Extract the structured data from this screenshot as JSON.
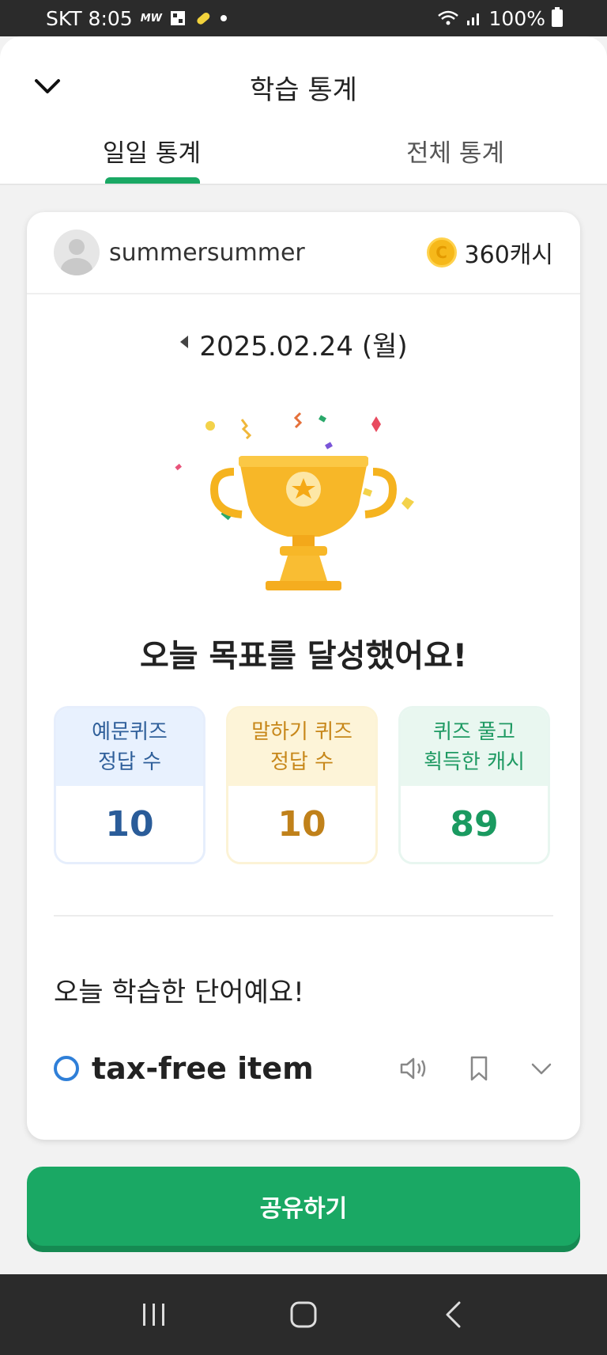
{
  "status_bar": {
    "carrier_time": "SKT 8:05",
    "mw": "MW",
    "battery": "100%"
  },
  "header": {
    "title": "학습 통계",
    "tabs": [
      {
        "label": "일일 통계",
        "active": true
      },
      {
        "label": "전체 통계",
        "active": false
      }
    ]
  },
  "profile": {
    "username": "summersummer",
    "cash": "360캐시",
    "coin_symbol": "C"
  },
  "date": "2025.02.24 (월)",
  "goal_message": "오늘 목표를 달성했어요!",
  "stats": [
    {
      "label": "예문퀴즈\n정답 수",
      "value": "10"
    },
    {
      "label": "말하기 퀴즈\n정답 수",
      "value": "10"
    },
    {
      "label": "퀴즈 풀고\n획득한 캐시",
      "value": "89"
    }
  ],
  "words_section": {
    "title": "오늘 학습한 단어예요!",
    "items": [
      {
        "word": "tax-free item"
      }
    ]
  },
  "share_button": "공유하기",
  "colors": {
    "accent_green": "#1aa864",
    "blue": "#2a5c99",
    "gold": "#c0811a",
    "coin": "#f6b81a"
  }
}
